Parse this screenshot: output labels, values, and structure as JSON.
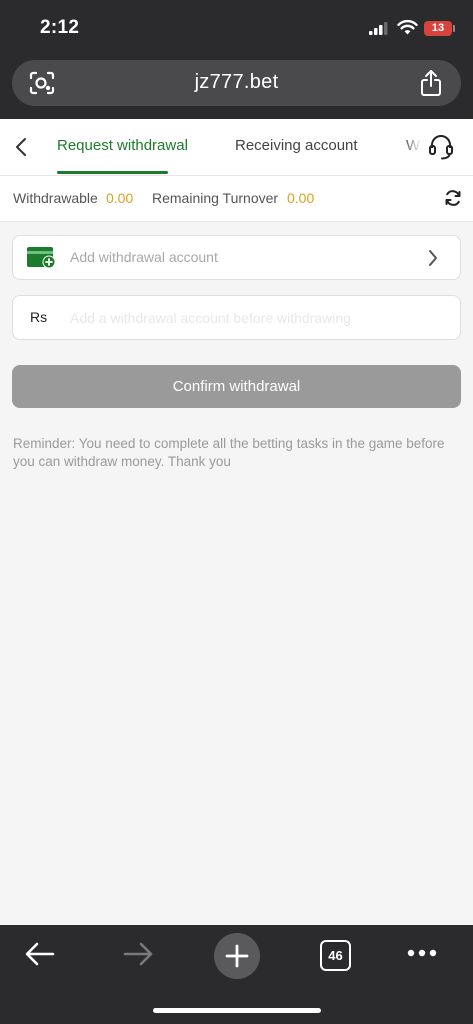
{
  "status_bar": {
    "time": "2:12",
    "battery": "13",
    "icons": [
      "signal-icon",
      "wifi-icon",
      "battery-icon"
    ]
  },
  "browser": {
    "url": "jz777.bet",
    "tab_count": "46",
    "icons": [
      "page-settings-icon",
      "share-icon",
      "back-arrow-icon",
      "forward-arrow-icon",
      "plus-icon",
      "more-icon"
    ]
  },
  "tabs": [
    {
      "label": "Request withdrawal",
      "active": true
    },
    {
      "label": "Receiving account",
      "active": false
    },
    {
      "label": "W",
      "active": false
    }
  ],
  "balances": {
    "withdrawable_label": "Withdrawable",
    "withdrawable_value": "0.00",
    "turnover_label": "Remaining Turnover",
    "turnover_value": "0.00"
  },
  "account": {
    "placeholder": "Add withdrawal account"
  },
  "amount": {
    "currency": "Rs",
    "placeholder": "Add a withdrawal account before withdrawing"
  },
  "confirm_label": "Confirm withdrawal",
  "reminder": "Reminder: You need to complete all the betting tasks in the game before you can withdraw money. Thank you",
  "colors": {
    "accent_green": "#1e7a2c",
    "value_gold": "#d9a31f",
    "disabled_button": "#9a9a9a",
    "chrome_dark": "#2b2b2d"
  }
}
